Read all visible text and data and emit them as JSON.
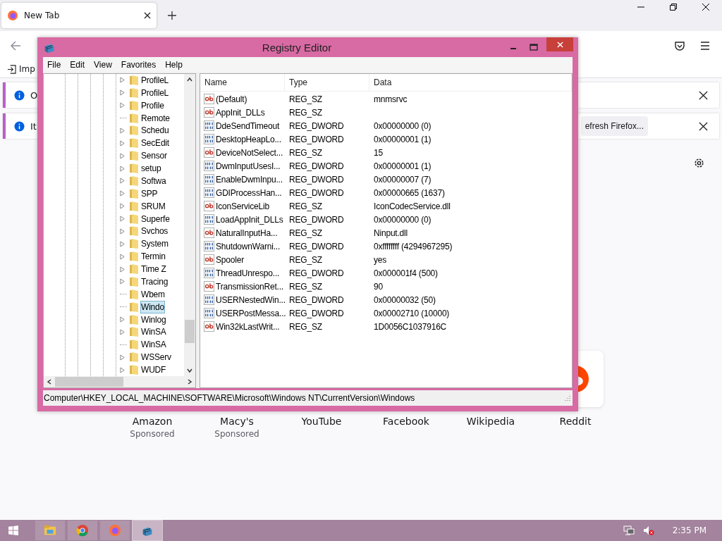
{
  "browser": {
    "tab": {
      "title": "New Tab"
    },
    "bookmarks": [
      {
        "label": "Imp"
      }
    ],
    "notifications": [
      {
        "text": "O"
      },
      {
        "text": "It",
        "button": "efresh Firefox..."
      }
    ],
    "shortcuts": [
      {
        "label": "Amazon",
        "sponsor": "Sponsored"
      },
      {
        "label": "Macy's",
        "sponsor": "Sponsored"
      },
      {
        "label": "YouTube"
      },
      {
        "label": "Facebook"
      },
      {
        "label": "Wikipedia"
      },
      {
        "label": "Reddit",
        "kind": "logo"
      }
    ]
  },
  "registry_editor": {
    "title": "Registry Editor",
    "menu": [
      "File",
      "Edit",
      "View",
      "Favorites",
      "Help"
    ],
    "tree": [
      {
        "label": "ProfileL",
        "expandable": true,
        "selected": false
      },
      {
        "label": "ProfileL",
        "expandable": true,
        "selected": false
      },
      {
        "label": "Profile",
        "expandable": true,
        "selected": false
      },
      {
        "label": "Remote",
        "expandable": false,
        "selected": false
      },
      {
        "label": "Schedu",
        "expandable": true,
        "selected": false
      },
      {
        "label": "SecEdit",
        "expandable": true,
        "selected": false
      },
      {
        "label": "Sensor",
        "expandable": true,
        "selected": false
      },
      {
        "label": "setup",
        "expandable": true,
        "selected": false
      },
      {
        "label": "Softwa",
        "expandable": true,
        "selected": false
      },
      {
        "label": "SPP",
        "expandable": true,
        "selected": false
      },
      {
        "label": "SRUM",
        "expandable": true,
        "selected": false
      },
      {
        "label": "Superfe",
        "expandable": true,
        "selected": false
      },
      {
        "label": "Svchos",
        "expandable": true,
        "selected": false
      },
      {
        "label": "System",
        "expandable": true,
        "selected": false
      },
      {
        "label": "Termin",
        "expandable": true,
        "selected": false
      },
      {
        "label": "Time Z",
        "expandable": true,
        "selected": false
      },
      {
        "label": "Tracing",
        "expandable": true,
        "selected": false
      },
      {
        "label": "Wbem",
        "expandable": false,
        "selected": false
      },
      {
        "label": "Windo",
        "expandable": false,
        "selected": true
      },
      {
        "label": "Winlog",
        "expandable": true,
        "selected": false
      },
      {
        "label": "WinSA",
        "expandable": true,
        "selected": false
      },
      {
        "label": "WinSA",
        "expandable": false,
        "selected": false
      },
      {
        "label": "WSServ",
        "expandable": true,
        "selected": false
      },
      {
        "label": "WUDF",
        "expandable": true,
        "selected": false
      }
    ],
    "columns": [
      "Name",
      "Type",
      "Data"
    ],
    "values": [
      {
        "kind": "sz",
        "name": "(Default)",
        "type": "REG_SZ",
        "data": "mnmsrvc"
      },
      {
        "kind": "sz",
        "name": "AppInit_DLLs",
        "type": "REG_SZ"
      },
      {
        "kind": "dword",
        "name": "DdeSendTimeout",
        "type": "REG_DWORD",
        "data": "0x00000000 (0)"
      },
      {
        "kind": "dword",
        "name": "DesktopHeapLo...",
        "type": "REG_DWORD",
        "data": "0x00000001 (1)"
      },
      {
        "kind": "sz",
        "name": "DeviceNotSelect...",
        "type": "REG_SZ",
        "data": "15"
      },
      {
        "kind": "dword",
        "name": "DwmInputUsesI...",
        "type": "REG_DWORD",
        "data": "0x00000001 (1)"
      },
      {
        "kind": "dword",
        "name": "EnableDwmInpu...",
        "type": "REG_DWORD",
        "data": "0x00000007 (7)"
      },
      {
        "kind": "dword",
        "name": "GDIProcessHan...",
        "type": "REG_DWORD",
        "data": "0x00000665 (1637)"
      },
      {
        "kind": "sz",
        "name": "IconServiceLib",
        "type": "REG_SZ",
        "data": "IconCodecService.dll"
      },
      {
        "kind": "dword",
        "name": "LoadAppInit_DLLs",
        "type": "REG_DWORD",
        "data": "0x00000000 (0)"
      },
      {
        "kind": "sz",
        "name": "NaturalInputHa...",
        "type": "REG_SZ",
        "data": "Ninput.dll"
      },
      {
        "kind": "dword",
        "name": "ShutdownWarni...",
        "type": "REG_DWORD",
        "data": "0xffffffff (4294967295)"
      },
      {
        "kind": "sz",
        "name": "Spooler",
        "type": "REG_SZ",
        "data": "yes"
      },
      {
        "kind": "dword",
        "name": "ThreadUnrespo...",
        "type": "REG_DWORD",
        "data": "0x000001f4 (500)"
      },
      {
        "kind": "sz",
        "name": "TransmissionRet...",
        "type": "REG_SZ",
        "data": "90"
      },
      {
        "kind": "dword",
        "name": "USERNestedWin...",
        "type": "REG_DWORD",
        "data": "0x00000032 (50)"
      },
      {
        "kind": "dword",
        "name": "USERPostMessa...",
        "type": "REG_DWORD",
        "data": "0x00002710 (10000)"
      },
      {
        "kind": "sz",
        "name": "Win32kLastWrit...",
        "type": "REG_SZ",
        "data": "1D0056C1037916C"
      }
    ],
    "status_path": "Computer\\HKEY_LOCAL_MACHINE\\SOFTWARE\\Microsoft\\Windows NT\\CurrentVersion\\Windows"
  },
  "taskbar": {
    "apps": [
      {
        "kind": "explorer",
        "selected": false
      },
      {
        "kind": "chrome",
        "selected": false
      },
      {
        "kind": "firefox",
        "selected": false
      },
      {
        "kind": "regedit",
        "selected": true
      }
    ],
    "clock": "2:35 PM"
  }
}
